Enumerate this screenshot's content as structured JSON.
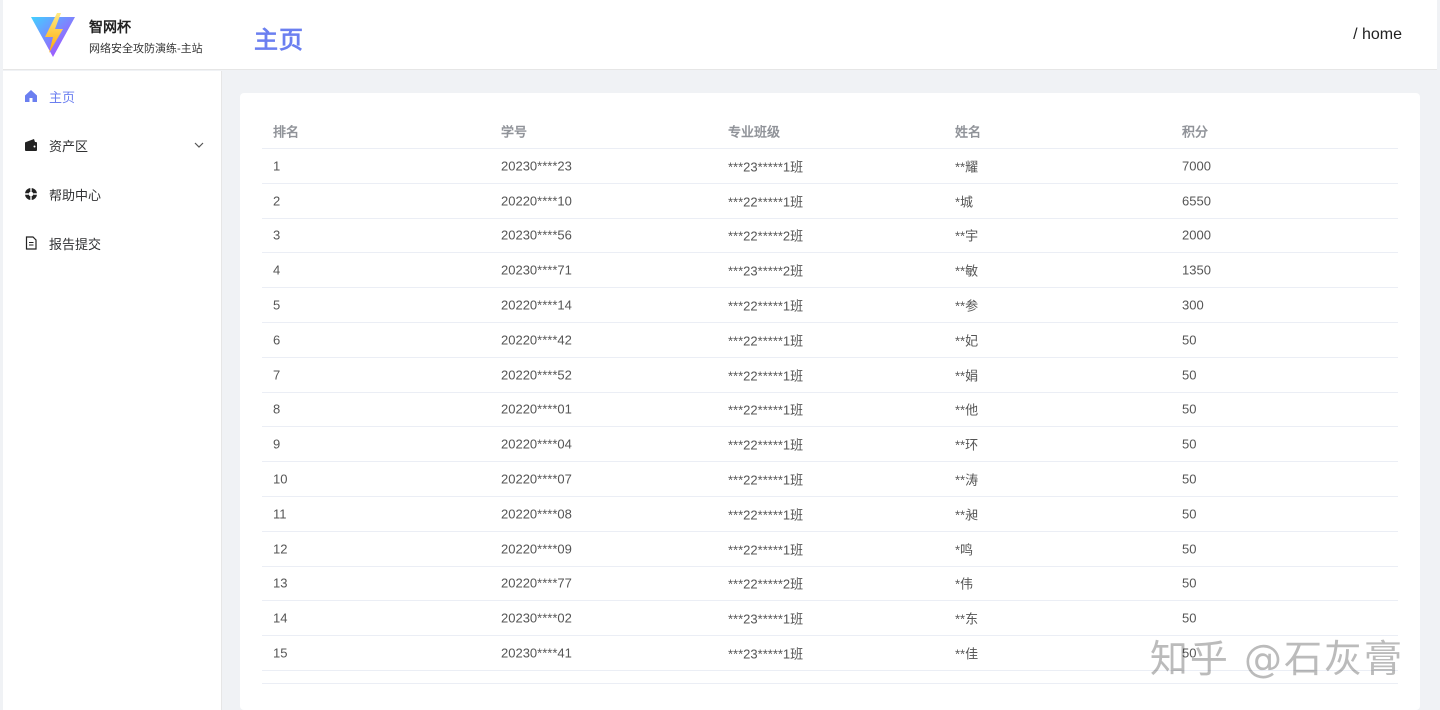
{
  "brand": {
    "title": "智网杯",
    "subtitle": "网络安全攻防演练-主站",
    "logo_icon": "vite-logo-icon"
  },
  "header": {
    "page_title": "主页",
    "breadcrumb": "/ home"
  },
  "sidebar": {
    "items": [
      {
        "label": "主页",
        "icon": "home-icon",
        "active": true
      },
      {
        "label": "资产区",
        "icon": "wallet-icon",
        "has_submenu": true
      },
      {
        "label": "帮助中心",
        "icon": "help-icon"
      },
      {
        "label": "报告提交",
        "icon": "document-icon"
      }
    ]
  },
  "table": {
    "headers": [
      "排名",
      "学号",
      "专业班级",
      "姓名",
      "积分"
    ],
    "rows": [
      [
        "1",
        "20230****23",
        "***23*****1班",
        "**耀",
        "7000"
      ],
      [
        "2",
        "20220****10",
        "***22*****1班",
        "*城",
        "6550"
      ],
      [
        "3",
        "20230****56",
        "***22*****2班",
        "**宇",
        "2000"
      ],
      [
        "4",
        "20230****71",
        "***23*****2班",
        "**敏",
        "1350"
      ],
      [
        "5",
        "20220****14",
        "***22*****1班",
        "**参",
        "300"
      ],
      [
        "6",
        "20220****42",
        "***22*****1班",
        "**妃",
        "50"
      ],
      [
        "7",
        "20220****52",
        "***22*****1班",
        "**娟",
        "50"
      ],
      [
        "8",
        "20220****01",
        "***22*****1班",
        "**他",
        "50"
      ],
      [
        "9",
        "20220****04",
        "***22*****1班",
        "**环",
        "50"
      ],
      [
        "10",
        "20220****07",
        "***22*****1班",
        "**涛",
        "50"
      ],
      [
        "11",
        "20220****08",
        "***22*****1班",
        "**昶",
        "50"
      ],
      [
        "12",
        "20220****09",
        "***22*****1班",
        "*鸣",
        "50"
      ],
      [
        "13",
        "20220****77",
        "***22*****2班",
        "*伟",
        "50"
      ],
      [
        "14",
        "20230****02",
        "***23*****1班",
        "**东",
        "50"
      ],
      [
        "15",
        "20230****41",
        "***23*****1班",
        "**佳",
        "50"
      ]
    ]
  },
  "watermark": "知乎 @石灰膏",
  "colors": {
    "accent": "#6b7ff0",
    "background": "#f0f2f5"
  }
}
